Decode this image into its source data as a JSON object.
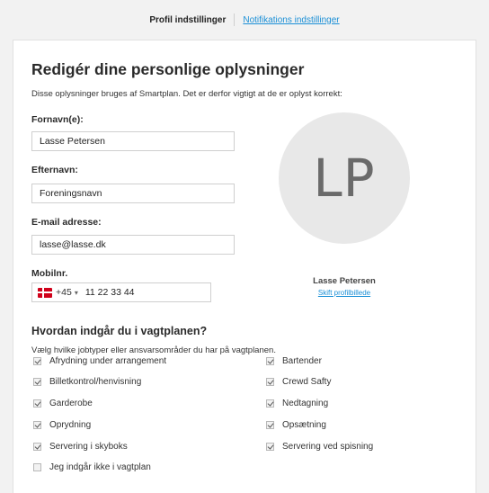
{
  "tabs": {
    "profile": "Profil indstillinger",
    "notifications": "Notifikations indstillinger"
  },
  "heading": "Redigér dine personlige oplysninger",
  "intro": "Disse oplysninger bruges af Smartplan. Det er derfor vigtigt at de er oplyst korrekt:",
  "fields": {
    "firstname": {
      "label": "Fornavn(e):",
      "value": "Lasse Petersen"
    },
    "lastname": {
      "label": "Efternavn:",
      "value": "Foreningsnavn"
    },
    "email": {
      "label": "E-mail adresse:",
      "value": "lasse@lasse.dk"
    },
    "mobile": {
      "label": "Mobilnr.",
      "dial_code": "+45",
      "value": "11 22 33 44"
    }
  },
  "profile": {
    "initials": "LP",
    "name": "Lasse Petersen",
    "change_picture": "Skift profilbillede"
  },
  "jobs": {
    "heading": "Hvordan indgår du i vagtplanen?",
    "intro": "Vælg hvilke jobtyper eller ansvarsområder du har på vagtplanen.",
    "left": [
      {
        "label": "Afrydning under arrangement",
        "checked": true
      },
      {
        "label": "Billetkontrol/henvisning",
        "checked": true
      },
      {
        "label": "Garderobe",
        "checked": true
      },
      {
        "label": "Oprydning",
        "checked": true
      },
      {
        "label": "Servering i skyboks",
        "checked": true
      },
      {
        "label": "Jeg indgår ikke i vagtplan",
        "checked": false
      }
    ],
    "right": [
      {
        "label": "Bartender",
        "checked": true
      },
      {
        "label": "Crewd Safty",
        "checked": true
      },
      {
        "label": "Nedtagning",
        "checked": true
      },
      {
        "label": "Opsætning",
        "checked": true
      },
      {
        "label": "Servering ved spisning",
        "checked": true
      }
    ]
  },
  "colors": {
    "link": "#1a8fd6",
    "avatar_bg": "#e8e8e8",
    "flag_red": "#d0021b"
  }
}
